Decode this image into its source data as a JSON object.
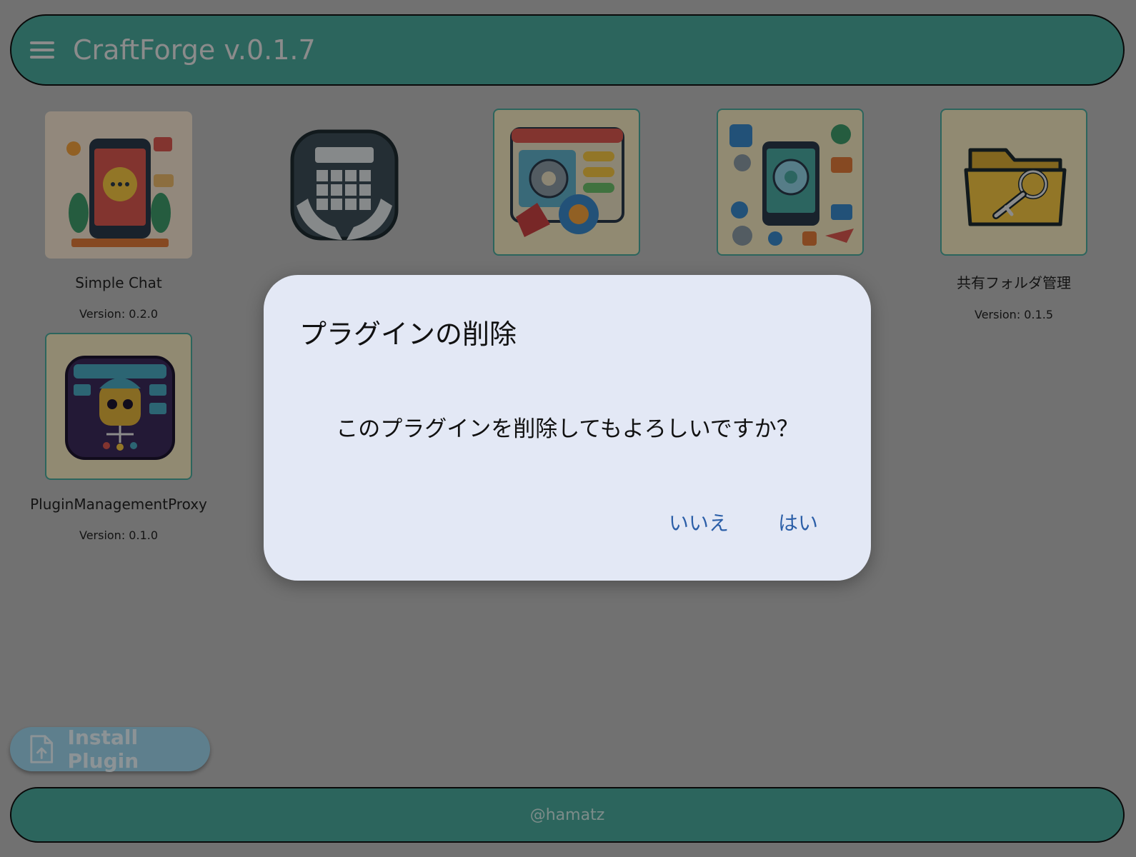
{
  "app_bar": {
    "title": "CraftForge v.0.1.7"
  },
  "plugins": [
    {
      "name": "Simple Chat",
      "version": "Version: 0.2.0"
    },
    {
      "name": "共有フォルダ管理",
      "version": "Version: 0.1.5"
    },
    {
      "name": "PluginManagementProxy",
      "version": "Version: 0.1.0"
    }
  ],
  "install_button": {
    "label": "Install Plugin"
  },
  "footer": {
    "text": "@hamatz"
  },
  "dialog": {
    "title": "プラグインの削除",
    "message": "このプラグインを削除してもよろしいですか？",
    "cancel_label": "いいえ",
    "confirm_label": "はい"
  },
  "colors": {
    "app_bar": "#4aa89c",
    "dialog_bg": "#e3e8f5",
    "dialog_button_text": "#2c5fa8",
    "install_button_bg": "#9dd4ec"
  }
}
